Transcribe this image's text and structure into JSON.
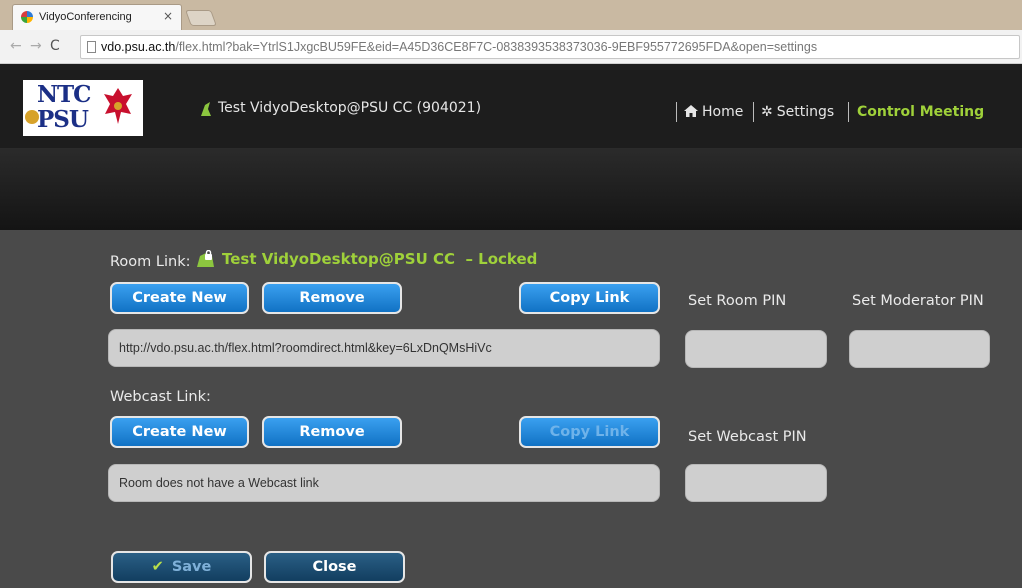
{
  "browser": {
    "tab_title": "VidyoConferencing",
    "tab_close": "×",
    "url_host": "vdo.psu.ac.th",
    "url_rest": "/flex.html?bak=YtrlS1JxgcBU59FE&eid=A45D36CE8F7C-0838393538373036-9EBF955772695FDA&open=settings"
  },
  "header": {
    "logo_text_top": "NTC",
    "logo_text_bottom": "PSU",
    "room_name": "Test VidyoDesktop@PSU CC (904021)",
    "nav": {
      "home": "Home",
      "settings": "Settings",
      "control": "Control Meeting"
    },
    "locked_title": "Test VidyoDesktop@PSU CC",
    "locked_status": "– Locked",
    "accent_color": "#9fd13a"
  },
  "room_link": {
    "label": "Room Link:",
    "create_new": "Create New",
    "remove": "Remove",
    "copy_link": "Copy Link",
    "value": "http://vdo.psu.ac.th/flex.html?roomdirect.html&key=6LxDnQMsHiVc"
  },
  "pins": {
    "room_pin_label": "Set Room PIN",
    "moderator_pin_label": "Set Moderator PIN",
    "webcast_pin_label": "Set Webcast PIN",
    "room_pin_value": "",
    "moderator_pin_value": "",
    "webcast_pin_value": ""
  },
  "webcast_link": {
    "label": "Webcast Link:",
    "create_new": "Create New",
    "remove": "Remove",
    "copy_link": "Copy Link",
    "value": "Room does not have a Webcast link"
  },
  "footer": {
    "save": "Save",
    "close": "Close"
  }
}
